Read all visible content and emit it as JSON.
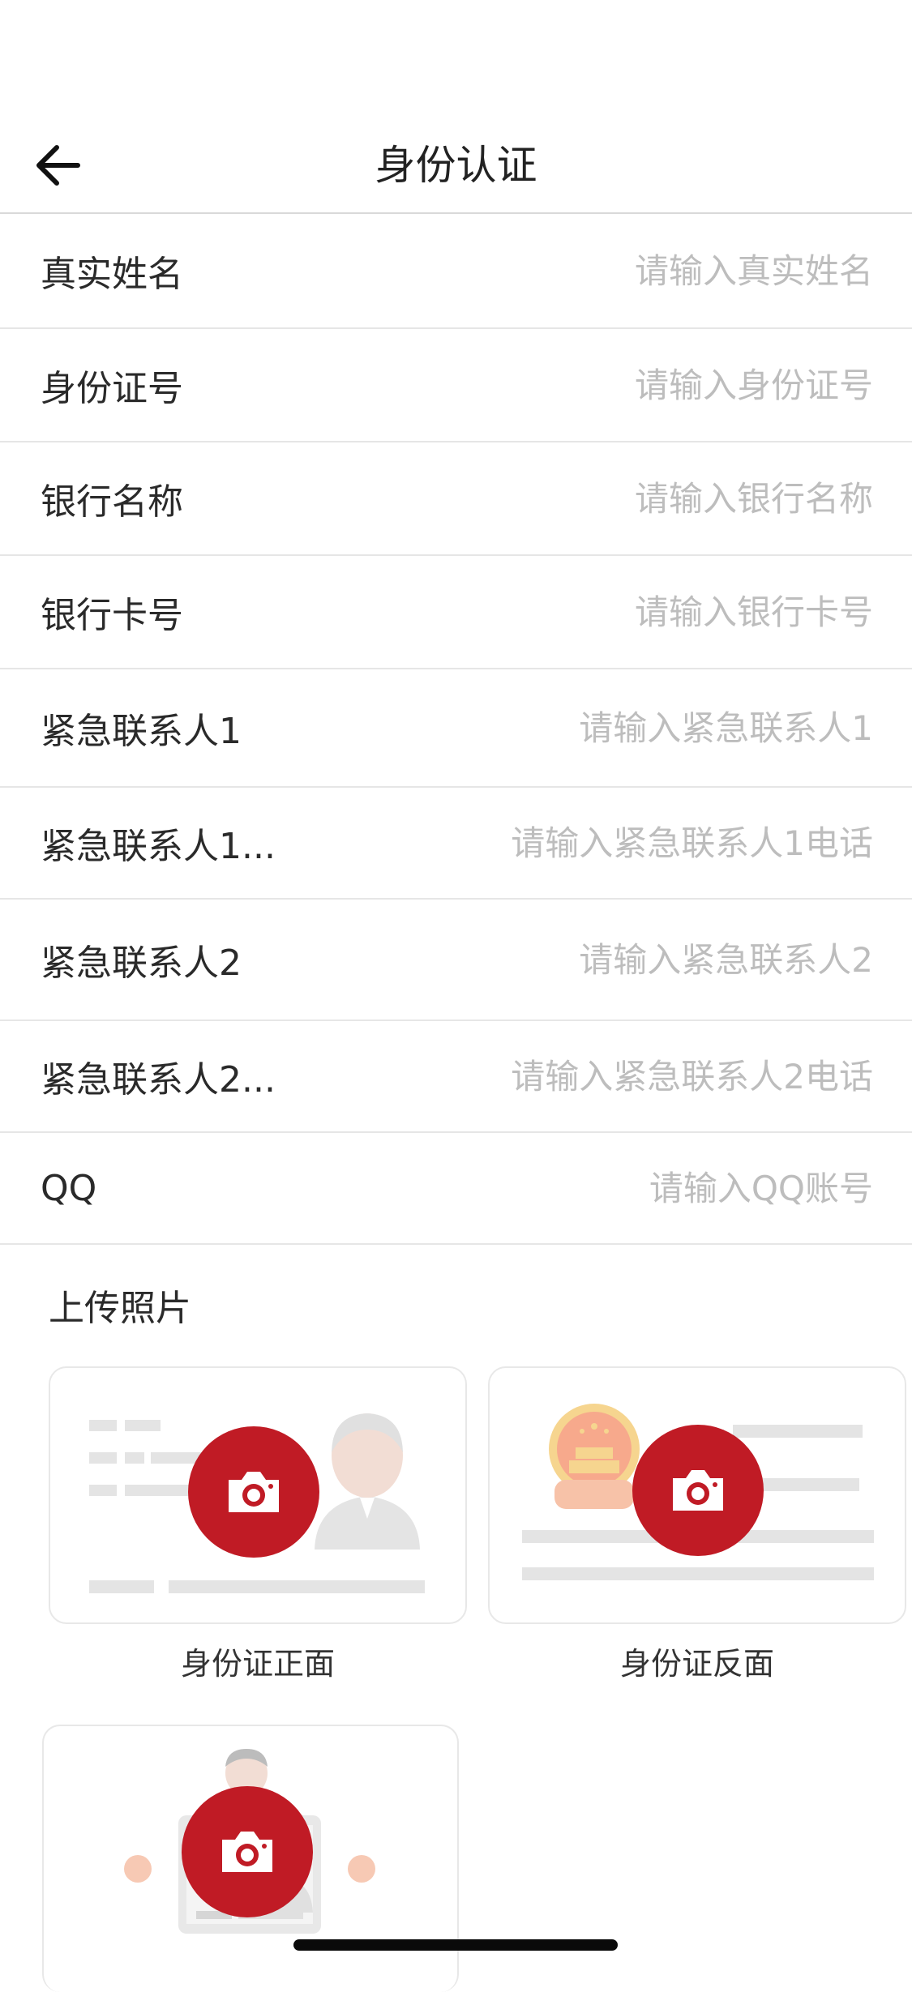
{
  "nav": {
    "title": "身份认证"
  },
  "form": {
    "rows": [
      {
        "label": "真实姓名",
        "placeholder": "请输入真实姓名"
      },
      {
        "label": "身份证号",
        "placeholder": "请输入身份证号"
      },
      {
        "label": "银行名称",
        "placeholder": "请输入银行名称"
      },
      {
        "label": "银行卡号",
        "placeholder": "请输入银行卡号"
      },
      {
        "label": "紧急联系人1",
        "placeholder": "请输入紧急联系人1"
      },
      {
        "label": "紧急联系人1...",
        "placeholder": "请输入紧急联系人1电话"
      },
      {
        "label": "紧急联系人2",
        "placeholder": "请输入紧急联系人2"
      },
      {
        "label": "紧急联系人2...",
        "placeholder": "请输入紧急联系人2电话"
      },
      {
        "label": "QQ",
        "placeholder": "请输入QQ账号"
      }
    ]
  },
  "upload": {
    "title": "上传照片",
    "cards": [
      {
        "caption": "身份证正面",
        "icon": "camera-icon"
      },
      {
        "caption": "身份证反面",
        "icon": "camera-icon"
      },
      {
        "caption": "",
        "icon": "camera-icon"
      }
    ]
  },
  "colors": {
    "accent": "#c01b25",
    "placeholder": "#bdbdbd",
    "divider": "#e6e6e6"
  }
}
